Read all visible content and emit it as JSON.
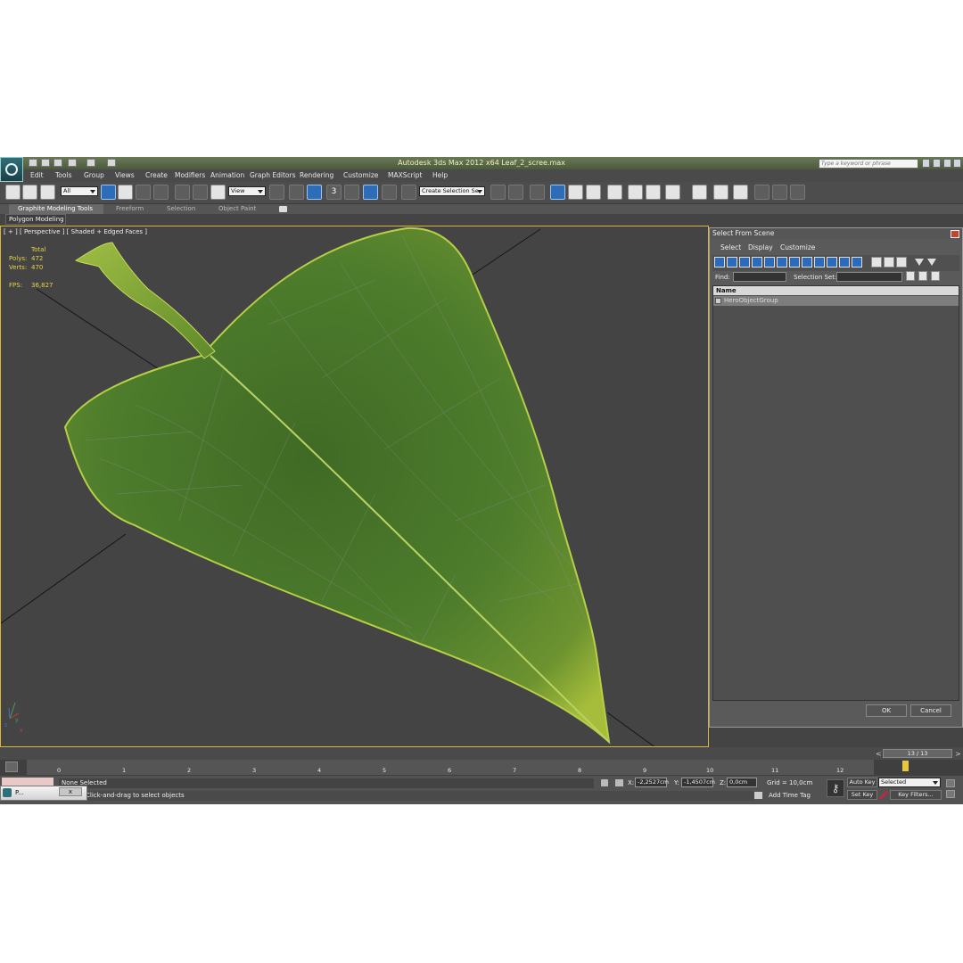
{
  "window": {
    "title": "Autodesk 3ds Max  2012 x64     Leaf_2_scree.max",
    "search_placeholder": "Type a keyword or phrase"
  },
  "menu": [
    "Edit",
    "Tools",
    "Group",
    "Views",
    "Create",
    "Modifiers",
    "Animation",
    "Graph Editors",
    "Rendering",
    "Customize",
    "MAXScript",
    "Help"
  ],
  "toolbar": {
    "selection_filter": "All",
    "reference_coord": "View",
    "named_selection": "Create Selection Se",
    "snap_label": "3"
  },
  "ribbon": {
    "tabs": [
      "Graphite Modeling Tools",
      "Freeform",
      "Selection",
      "Object Paint"
    ],
    "panel": "Polygon Modeling"
  },
  "viewport": {
    "label": "[ + ] [ Perspective ] [ Shaded + Edged Faces ]",
    "stats": {
      "header": "Total",
      "polys_label": "Polys:",
      "polys_value": "472",
      "verts_label": "Verts:",
      "verts_value": "470",
      "fps_label": "FPS:",
      "fps_value": "36,827"
    },
    "axis_labels": [
      "y",
      "x",
      "z"
    ]
  },
  "select_dialog": {
    "title": "Select From Scene",
    "menu": [
      "Select",
      "Display",
      "Customize"
    ],
    "find_label": "Find:",
    "selection_set_label": "Selection Set:",
    "column_header": "Name",
    "items": [
      "HeroObjectGroup"
    ],
    "ok": "OK",
    "cancel": "Cancel"
  },
  "timeline": {
    "frame_counter": "13 / 13",
    "ticks": [
      "0",
      "1",
      "2",
      "3",
      "4",
      "5",
      "6",
      "7",
      "8",
      "9",
      "10",
      "11",
      "12"
    ]
  },
  "status": {
    "selection": "None Selected",
    "prompt": "Click-and-drag to select objects",
    "x_label": "X:",
    "x_value": "-2,2527cm",
    "y_label": "Y:",
    "y_value": "-1,4507cm",
    "z_label": "Z:",
    "z_value": "0,0cm",
    "grid": "Grid = 10,0cm",
    "add_time_tag": "Add Time Tag",
    "auto_key": "Auto Key",
    "set_key": "Set Key",
    "key_mode": "Selected",
    "key_filters": "Key Filters..."
  },
  "taskbar": {
    "item": "P...",
    "close": "x"
  },
  "colors": {
    "viewport_bg": "#444444",
    "viewport_border": "#d9b53a",
    "stats_text": "#e8d24a",
    "leaf_green": "#4f7a2a",
    "leaf_edge": "#a7c03a"
  }
}
